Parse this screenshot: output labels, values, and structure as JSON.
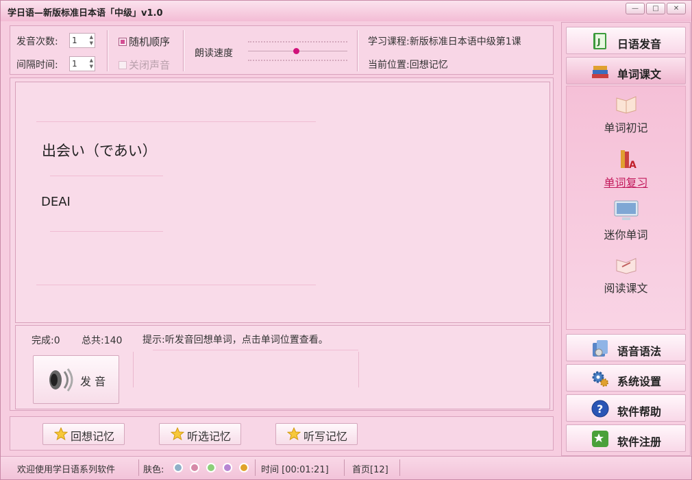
{
  "window": {
    "title": "学日语—新版标准日本语「中级」v1.0"
  },
  "controls": {
    "repeat_label": "发音次数:",
    "repeat_value": "1",
    "interval_label": "间隔时间:",
    "interval_value": "1",
    "random_label": "随机顺序",
    "mute_label": "关闭声音",
    "speed_label": "朗读速度",
    "course_label": "学习课程:",
    "course_value": "新版标准日本语中级第1课",
    "position_label": "当前位置:",
    "position_value": "回想记忆"
  },
  "word": {
    "kana": "出会い（であい）",
    "romaji": "DEAI"
  },
  "progress": {
    "done_label": "完成:0",
    "total_label": "总共:140",
    "hint": "提示:听发音回想单词，点击单词位置查看。"
  },
  "play_button": {
    "label": "发 音"
  },
  "mode_buttons": [
    {
      "label": "回想记忆"
    },
    {
      "label": "听选记忆"
    },
    {
      "label": "听写记忆"
    }
  ],
  "sidebar": {
    "top": [
      {
        "label": "日语发音",
        "icon": "book-j-icon"
      },
      {
        "label": "单词课文",
        "icon": "books-stack-icon"
      }
    ],
    "subitems": [
      {
        "label": "单词初记",
        "icon": "open-book-icon"
      },
      {
        "label": "单词复习",
        "icon": "books-a-icon"
      },
      {
        "label": "迷你单词",
        "icon": "monitor-icon"
      },
      {
        "label": "阅读课文",
        "icon": "reading-book-icon"
      }
    ],
    "bottom": [
      {
        "label": "语音语法",
        "icon": "audio-book-icon"
      },
      {
        "label": "系统设置",
        "icon": "gears-icon"
      },
      {
        "label": "软件帮助",
        "icon": "help-icon"
      },
      {
        "label": "软件注册",
        "icon": "register-icon"
      }
    ]
  },
  "status": {
    "welcome": "欢迎使用学日语系列软件",
    "skin_label": "肤色:",
    "skin_colors": [
      "#8fb0c8",
      "#d689a8",
      "#8ccf7a",
      "#b785d3",
      "#e0a32a"
    ],
    "time": "时间 [00:01:21]",
    "page": "首页[12]"
  },
  "colors": {
    "accent": "#d34f93",
    "link": "#c2185b"
  }
}
